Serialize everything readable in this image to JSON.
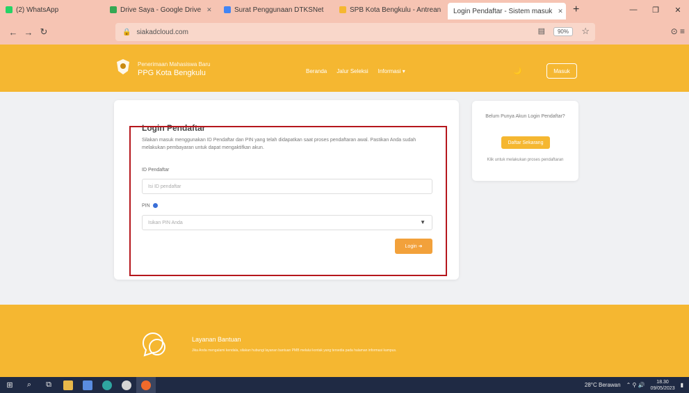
{
  "browser": {
    "tabs": [
      {
        "label": "(2) WhatsApp",
        "color": "#25d366"
      },
      {
        "label": "Drive Saya - Google Drive",
        "color": "#34a853"
      },
      {
        "label": "Surat Penggunaan DTKSNet",
        "color": "#4285f4"
      },
      {
        "label": "SPB Kota Bengkulu - Antrean",
        "color": "#f5b731"
      },
      {
        "label": "Login Pendaftar - Sistem masuk",
        "color": "#f5b731"
      }
    ],
    "new_tab": "+",
    "url": "siakadcloud.com",
    "zoom": "90%"
  },
  "site": {
    "brand_line1": "Penerimaan Mahasiswa Baru",
    "brand_line2": "PPG Kota Bengkulu",
    "menu": [
      "Beranda",
      "Jalur Seleksi",
      "Informasi ▾"
    ],
    "theme_label": "🌙",
    "login_header": "Masuk"
  },
  "login": {
    "title": "Login Pendaftar",
    "description": "Silakan masuk menggunakan ID Pendaftar dan PIN yang telah didapatkan saat proses pendaftaran awal. Pastikan Anda sudah melakukan pembayaran untuk dapat mengaktifkan akun.",
    "id_label": "ID Pendaftar",
    "id_placeholder": "Isi ID pendaftar",
    "pin_label": "PIN",
    "pin_placeholder": "Isikan PIN Anda",
    "submit_label": "Login ➜"
  },
  "side": {
    "question": "Belum Punya Akun Login Pendaftar?",
    "button": "Daftar Sekarang",
    "note": "Klik untuk melakukan proses pendaftaran"
  },
  "footer": {
    "title": "Layanan Bantuan",
    "text": "Jika Anda mengalami kendala, silakan hubungi layanan bantuan PMB melalui kontak yang tersedia pada halaman informasi kampus."
  },
  "taskbar": {
    "weather": "28°C  Berawan",
    "time": "18.30",
    "date": "09/05/2023"
  }
}
